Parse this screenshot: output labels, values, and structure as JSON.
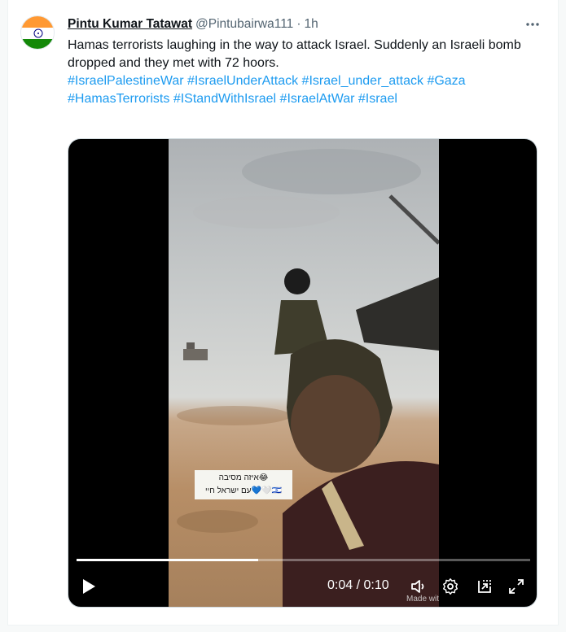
{
  "tweet": {
    "display_name": "Pintu Kumar Tatawat",
    "handle": "@Pintubairwa111",
    "separator": "·",
    "time": "1h",
    "more_icon": "more-horizontal-icon",
    "text_line1": "Hamas terrorists laughing in the way to attack Israel. Suddenly an Israeli bomb dropped and they met with 72 hoors.",
    "hashtags": [
      "#IsraelPalestineWar",
      "#IsraelUnderAttack",
      "#Israel_under_attack",
      "#Gaza",
      "#HamasTerrorists",
      "#IStandWithIsrael",
      "#IsraelAtWar",
      "#Israel"
    ]
  },
  "avatar": {
    "icon": "india-flag-avatar",
    "colors": {
      "saffron": "#ff9933",
      "white": "#ffffff",
      "green": "#138808",
      "chakra": "#000080"
    }
  },
  "video": {
    "current_time": "0:04",
    "separator": " / ",
    "duration": "0:10",
    "progress": 0.4,
    "caption_line1": "איזה מסיבה😂",
    "caption_line2": "עם ישראל חיי💙🤍🇮🇱",
    "watermark": "Made with"
  },
  "colors": {
    "accent": "#1d9bf0",
    "text": "#0f1419",
    "muted": "#536471"
  }
}
